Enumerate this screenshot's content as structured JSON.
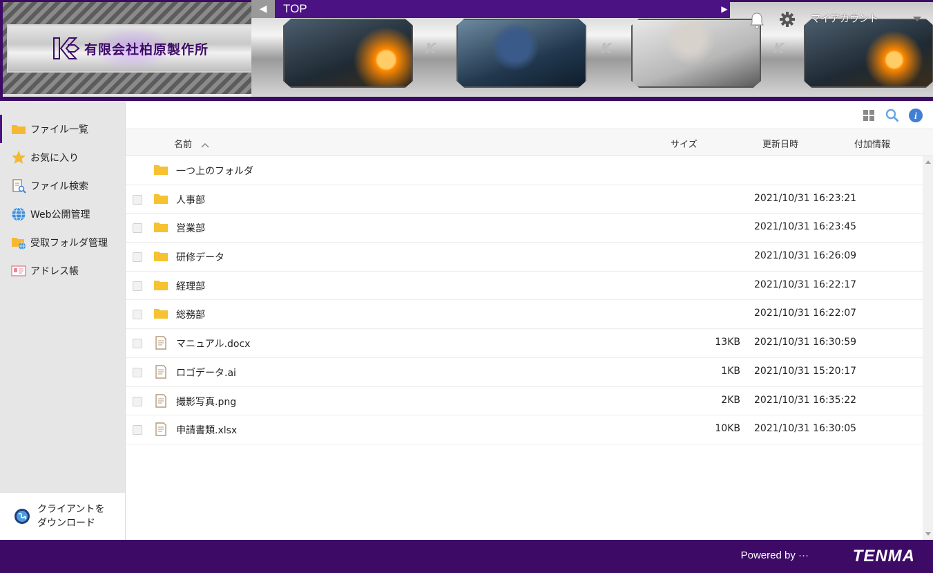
{
  "header": {
    "company_name": "有限会社柏原製作所",
    "breadcrumb_title": "TOP",
    "account_label": "マイアカウント"
  },
  "sidebar": {
    "items": [
      {
        "label": "ファイル一覧",
        "icon": "folder-icon"
      },
      {
        "label": "お気に入り",
        "icon": "star-icon"
      },
      {
        "label": "ファイル検索",
        "icon": "file-search-icon"
      },
      {
        "label": "Web公開管理",
        "icon": "globe-icon"
      },
      {
        "label": "受取フォルダ管理",
        "icon": "folder-globe-icon"
      },
      {
        "label": "アドレス帳",
        "icon": "address-card-icon"
      }
    ],
    "download_label": "クライアントを\nダウンロード"
  },
  "list": {
    "columns": {
      "name": "名前",
      "size": "サイズ",
      "updated": "更新日時",
      "extra": "付加情報"
    },
    "parent_folder": "一つ上のフォルダ",
    "rows": [
      {
        "type": "folder",
        "name": "人事部",
        "size": "",
        "updated": "2021/10/31 16:23:21"
      },
      {
        "type": "folder",
        "name": "営業部",
        "size": "",
        "updated": "2021/10/31 16:23:45"
      },
      {
        "type": "folder",
        "name": "研修データ",
        "size": "",
        "updated": "2021/10/31 16:26:09"
      },
      {
        "type": "folder",
        "name": "経理部",
        "size": "",
        "updated": "2021/10/31 16:22:17"
      },
      {
        "type": "folder",
        "name": "総務部",
        "size": "",
        "updated": "2021/10/31 16:22:07"
      },
      {
        "type": "file",
        "name": "マニュアル.docx",
        "size": "13KB",
        "updated": "2021/10/31 16:30:59"
      },
      {
        "type": "file",
        "name": "ロゴデータ.ai",
        "size": "1KB",
        "updated": "2021/10/31 15:20:17"
      },
      {
        "type": "file",
        "name": "撮影写真.png",
        "size": "2KB",
        "updated": "2021/10/31 16:35:22"
      },
      {
        "type": "file",
        "name": "申請書類.xlsx",
        "size": "10KB",
        "updated": "2021/10/31 16:30:05"
      }
    ]
  },
  "footer": {
    "powered_by": "Powered by",
    "brand": "TENMA"
  },
  "colors": {
    "brand_purple": "#3d0a66",
    "folder_yellow": "#f6c232",
    "info_blue": "#3f7fd6"
  }
}
